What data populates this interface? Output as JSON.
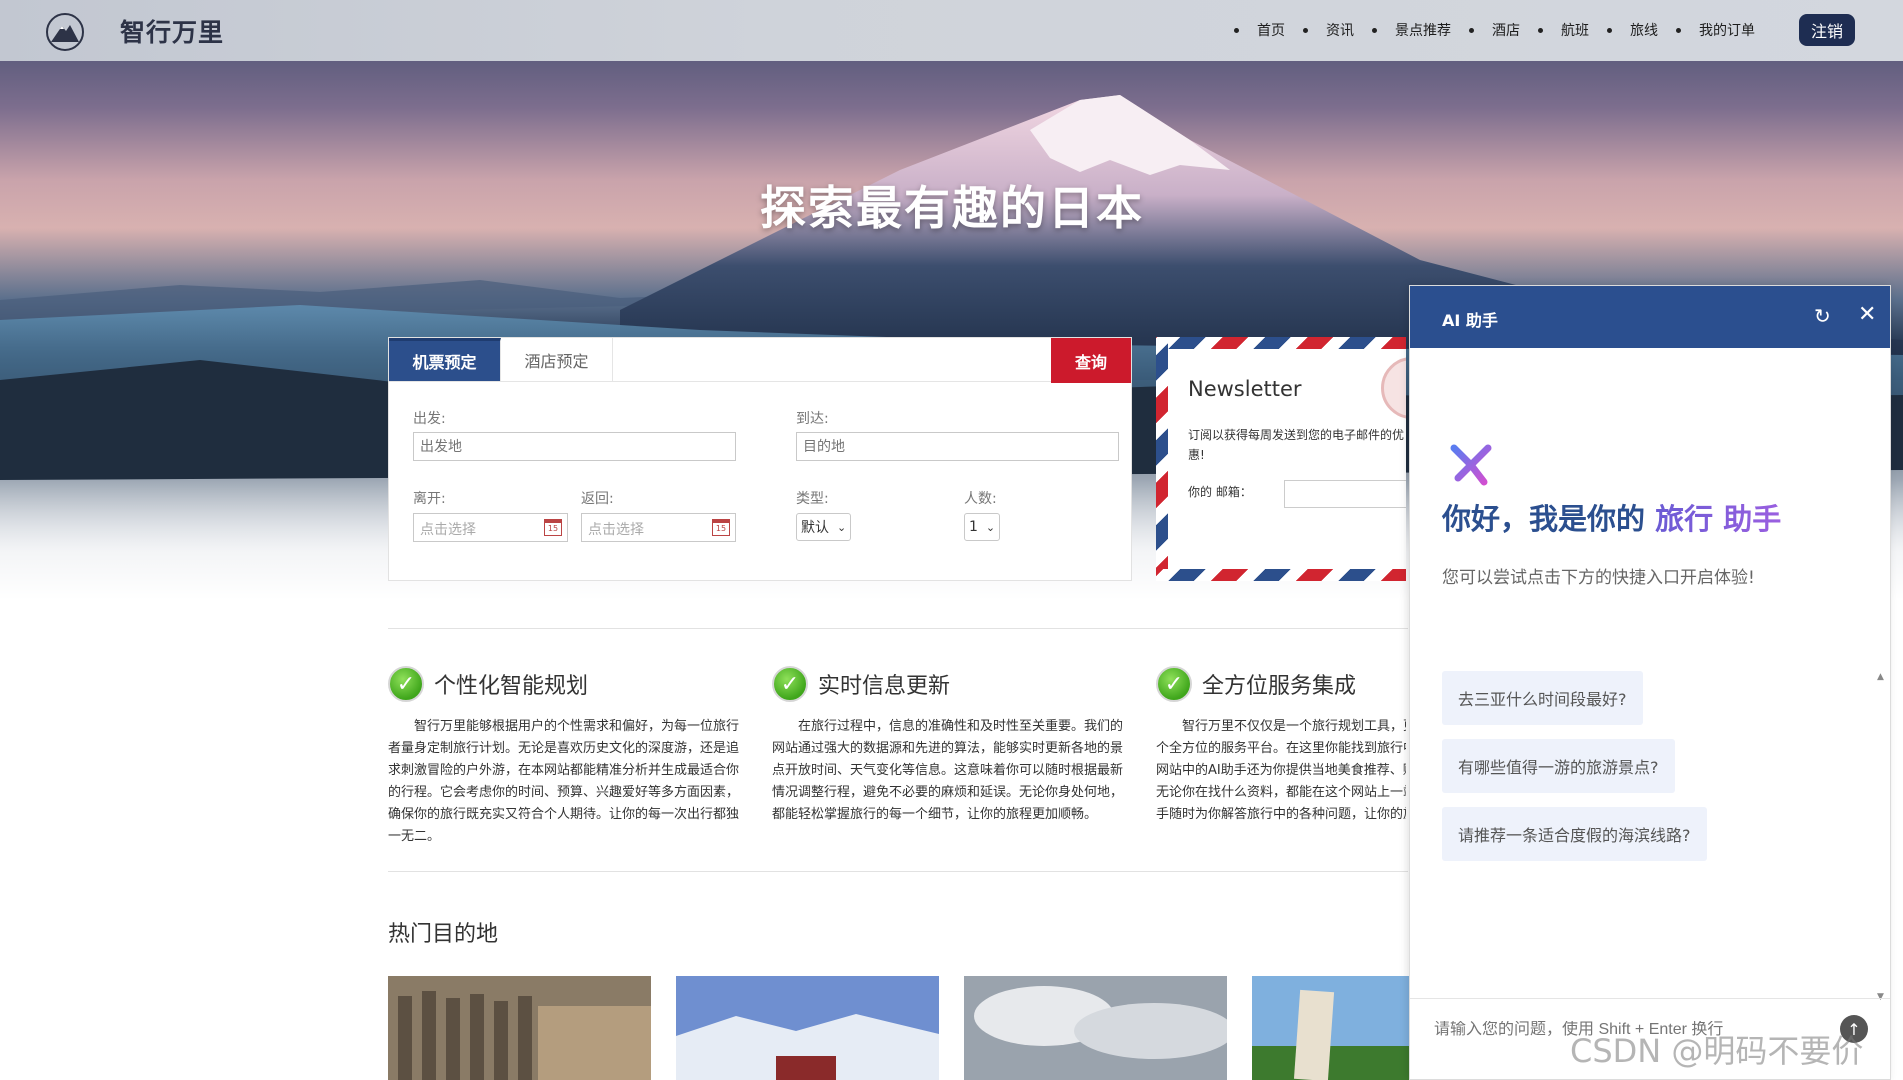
{
  "header": {
    "brand": "智行万里",
    "nav": [
      "首页",
      "资讯",
      "景点推荐",
      "酒店",
      "航班",
      "旅线",
      "我的订单"
    ],
    "logout": "注销"
  },
  "hero": {
    "title": "探索最有趣的日本"
  },
  "booking": {
    "tabs": [
      "机票预定",
      "酒店预定"
    ],
    "query_button": "查询",
    "from_label": "出发:",
    "from_placeholder": "出发地",
    "to_label": "到达:",
    "to_placeholder": "目的地",
    "depart_label": "离开:",
    "depart_placeholder": "点击选择",
    "return_label": "返回:",
    "return_placeholder": "点击选择",
    "type_label": "类型:",
    "type_value": "默认",
    "people_label": "人数:",
    "people_value": "1"
  },
  "newsletter": {
    "title": "Newsletter",
    "text": "订阅以获得每周发送到您的电子邮件的优惠!",
    "email_label": "你的 邮箱："
  },
  "features": [
    {
      "title": "个性化智能规划",
      "text": "智行万里能够根据用户的个性需求和偏好，为每一位旅行者量身定制旅行计划。无论是喜欢历史文化的深度游，还是追求刺激冒险的户外游，在本网站都能精准分析并生成最适合你的行程。它会考虑你的时间、预算、兴趣爱好等多方面因素，确保你的旅行既充实又符合个人期待。让你的每一次出行都独一无二。"
    },
    {
      "title": "实时信息更新",
      "text": "在旅行过程中，信息的准确性和及时性至关重要。我们的网站通过强大的数据源和先进的算法，能够实时更新各地的景点开放时间、天气变化等信息。这意味着你可以随时根据最新情况调整行程，避免不必要的麻烦和延误。无论你身处何地，都能轻松掌握旅行的每一个细节，让你的旅程更加顺畅。"
    },
    {
      "title": "全方位服务集成",
      "text": "智行万里不仅仅是一个旅行规划工具，更加持，它更是一个全方位的服务平台。在这里你能找到旅行中所需要的信息。网站中的AI助手还为你提供当地美食推荐、购物指南等服务。无论你在找什么资料，都能在这个网站上一站式解决。智能助手随时为你解答旅行中的各种问题，让你的旅行无忧。"
    }
  ],
  "destinations": {
    "title": "热门目的地"
  },
  "ai": {
    "title": "AI 助手",
    "greet_1": "你好，我是你的 ",
    "greet_2": "旅行 助手",
    "sub": "您可以尝试点击下方的快捷入口开启体验!",
    "suggestions": [
      "去三亚什么时间段最好?",
      "有哪些值得一游的旅游景点?",
      "请推荐一条适合度假的海滨线路?"
    ],
    "input_placeholder": "请输入您的问题，使用 Shift + Enter 换行"
  },
  "watermark": "CSDN @明码不要价",
  "colors": {
    "primary": "#2b4f8f",
    "query_red": "#cc1a2c",
    "logout_bg": "#1e2d52"
  }
}
